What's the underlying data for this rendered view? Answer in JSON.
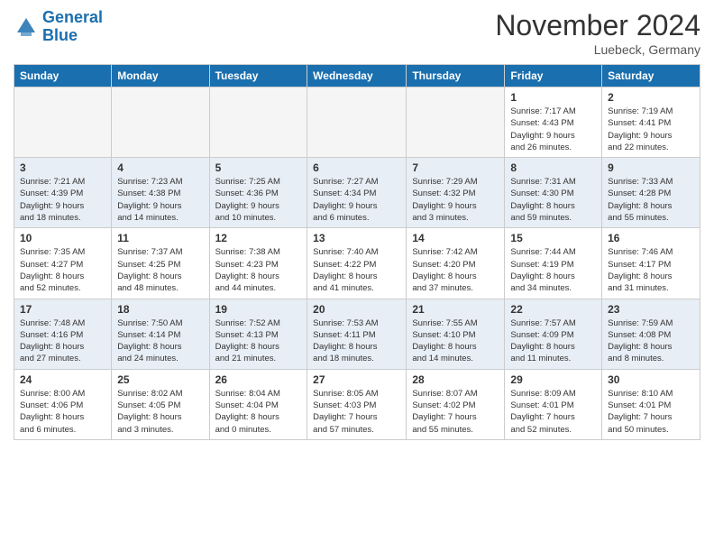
{
  "header": {
    "logo_line1": "General",
    "logo_line2": "Blue",
    "month": "November 2024",
    "location": "Luebeck, Germany"
  },
  "columns": [
    "Sunday",
    "Monday",
    "Tuesday",
    "Wednesday",
    "Thursday",
    "Friday",
    "Saturday"
  ],
  "weeks": [
    [
      {
        "day": "",
        "info": ""
      },
      {
        "day": "",
        "info": ""
      },
      {
        "day": "",
        "info": ""
      },
      {
        "day": "",
        "info": ""
      },
      {
        "day": "",
        "info": ""
      },
      {
        "day": "1",
        "info": "Sunrise: 7:17 AM\nSunset: 4:43 PM\nDaylight: 9 hours\nand 26 minutes."
      },
      {
        "day": "2",
        "info": "Sunrise: 7:19 AM\nSunset: 4:41 PM\nDaylight: 9 hours\nand 22 minutes."
      }
    ],
    [
      {
        "day": "3",
        "info": "Sunrise: 7:21 AM\nSunset: 4:39 PM\nDaylight: 9 hours\nand 18 minutes."
      },
      {
        "day": "4",
        "info": "Sunrise: 7:23 AM\nSunset: 4:38 PM\nDaylight: 9 hours\nand 14 minutes."
      },
      {
        "day": "5",
        "info": "Sunrise: 7:25 AM\nSunset: 4:36 PM\nDaylight: 9 hours\nand 10 minutes."
      },
      {
        "day": "6",
        "info": "Sunrise: 7:27 AM\nSunset: 4:34 PM\nDaylight: 9 hours\nand 6 minutes."
      },
      {
        "day": "7",
        "info": "Sunrise: 7:29 AM\nSunset: 4:32 PM\nDaylight: 9 hours\nand 3 minutes."
      },
      {
        "day": "8",
        "info": "Sunrise: 7:31 AM\nSunset: 4:30 PM\nDaylight: 8 hours\nand 59 minutes."
      },
      {
        "day": "9",
        "info": "Sunrise: 7:33 AM\nSunset: 4:28 PM\nDaylight: 8 hours\nand 55 minutes."
      }
    ],
    [
      {
        "day": "10",
        "info": "Sunrise: 7:35 AM\nSunset: 4:27 PM\nDaylight: 8 hours\nand 52 minutes."
      },
      {
        "day": "11",
        "info": "Sunrise: 7:37 AM\nSunset: 4:25 PM\nDaylight: 8 hours\nand 48 minutes."
      },
      {
        "day": "12",
        "info": "Sunrise: 7:38 AM\nSunset: 4:23 PM\nDaylight: 8 hours\nand 44 minutes."
      },
      {
        "day": "13",
        "info": "Sunrise: 7:40 AM\nSunset: 4:22 PM\nDaylight: 8 hours\nand 41 minutes."
      },
      {
        "day": "14",
        "info": "Sunrise: 7:42 AM\nSunset: 4:20 PM\nDaylight: 8 hours\nand 37 minutes."
      },
      {
        "day": "15",
        "info": "Sunrise: 7:44 AM\nSunset: 4:19 PM\nDaylight: 8 hours\nand 34 minutes."
      },
      {
        "day": "16",
        "info": "Sunrise: 7:46 AM\nSunset: 4:17 PM\nDaylight: 8 hours\nand 31 minutes."
      }
    ],
    [
      {
        "day": "17",
        "info": "Sunrise: 7:48 AM\nSunset: 4:16 PM\nDaylight: 8 hours\nand 27 minutes."
      },
      {
        "day": "18",
        "info": "Sunrise: 7:50 AM\nSunset: 4:14 PM\nDaylight: 8 hours\nand 24 minutes."
      },
      {
        "day": "19",
        "info": "Sunrise: 7:52 AM\nSunset: 4:13 PM\nDaylight: 8 hours\nand 21 minutes."
      },
      {
        "day": "20",
        "info": "Sunrise: 7:53 AM\nSunset: 4:11 PM\nDaylight: 8 hours\nand 18 minutes."
      },
      {
        "day": "21",
        "info": "Sunrise: 7:55 AM\nSunset: 4:10 PM\nDaylight: 8 hours\nand 14 minutes."
      },
      {
        "day": "22",
        "info": "Sunrise: 7:57 AM\nSunset: 4:09 PM\nDaylight: 8 hours\nand 11 minutes."
      },
      {
        "day": "23",
        "info": "Sunrise: 7:59 AM\nSunset: 4:08 PM\nDaylight: 8 hours\nand 8 minutes."
      }
    ],
    [
      {
        "day": "24",
        "info": "Sunrise: 8:00 AM\nSunset: 4:06 PM\nDaylight: 8 hours\nand 6 minutes."
      },
      {
        "day": "25",
        "info": "Sunrise: 8:02 AM\nSunset: 4:05 PM\nDaylight: 8 hours\nand 3 minutes."
      },
      {
        "day": "26",
        "info": "Sunrise: 8:04 AM\nSunset: 4:04 PM\nDaylight: 8 hours\nand 0 minutes."
      },
      {
        "day": "27",
        "info": "Sunrise: 8:05 AM\nSunset: 4:03 PM\nDaylight: 7 hours\nand 57 minutes."
      },
      {
        "day": "28",
        "info": "Sunrise: 8:07 AM\nSunset: 4:02 PM\nDaylight: 7 hours\nand 55 minutes."
      },
      {
        "day": "29",
        "info": "Sunrise: 8:09 AM\nSunset: 4:01 PM\nDaylight: 7 hours\nand 52 minutes."
      },
      {
        "day": "30",
        "info": "Sunrise: 8:10 AM\nSunset: 4:01 PM\nDaylight: 7 hours\nand 50 minutes."
      }
    ]
  ]
}
